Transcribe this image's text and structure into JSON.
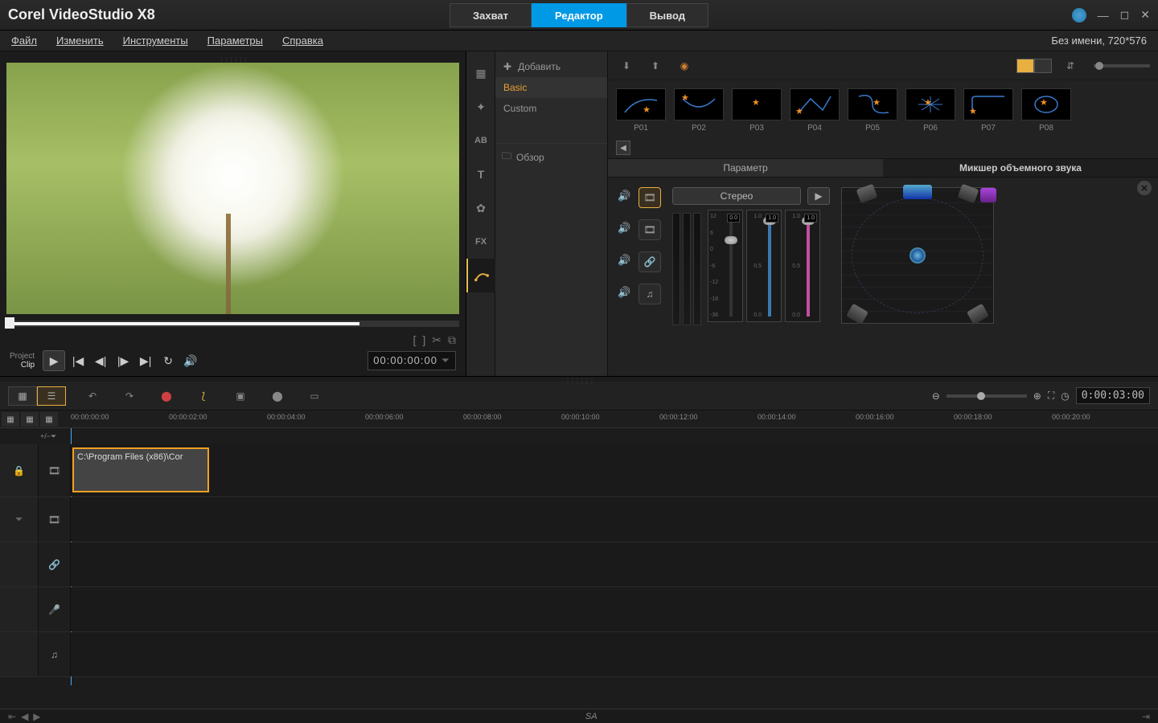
{
  "app": {
    "title": "Corel  VideoStudio X8"
  },
  "topTabs": {
    "capture": "Захват",
    "editor": "Редактор",
    "output": "Вывод"
  },
  "menu": {
    "file": "Файл",
    "edit": "Изменить",
    "tools": "Инструменты",
    "options": "Параметры",
    "help": "Справка"
  },
  "project": {
    "info": "Без имени, 720*576"
  },
  "preview": {
    "projectLabel": "Project",
    "clipLabel": "Clip",
    "timecode": "00:00:00:00"
  },
  "library": {
    "add": "Добавить",
    "cat_basic": "Basic",
    "cat_custom": "Custom",
    "browse": "Обзор",
    "presets": [
      {
        "label": "P01"
      },
      {
        "label": "P02"
      },
      {
        "label": "P03"
      },
      {
        "label": "P04"
      },
      {
        "label": "P05"
      },
      {
        "label": "P06"
      },
      {
        "label": "P07"
      },
      {
        "label": "P08"
      }
    ]
  },
  "subtabs": {
    "param": "Параметр",
    "mixer": "Микшер объемного звука"
  },
  "mixer": {
    "stereo": "Стерео",
    "scale": [
      "12",
      "6",
      "0",
      "-6",
      "-12",
      "-18",
      "-36"
    ],
    "val0": "0.0",
    "val1": "1.0",
    "val2": "1.0"
  },
  "timeline": {
    "duration": "0:00:03:00",
    "marks": [
      "00:00:00:00",
      "00:00:02:00",
      "00:00:04:00",
      "00:00:06:00",
      "00:00:08:00",
      "00:00:10:00",
      "00:00:12:00",
      "00:00:14:00",
      "00:00:16:00",
      "00:00:18:00",
      "00:00:20:00"
    ],
    "clip": "C:\\Program Files (x86)\\Cor",
    "addTrack": "+/−⏷"
  },
  "bottom": {
    "sa": "SA"
  }
}
